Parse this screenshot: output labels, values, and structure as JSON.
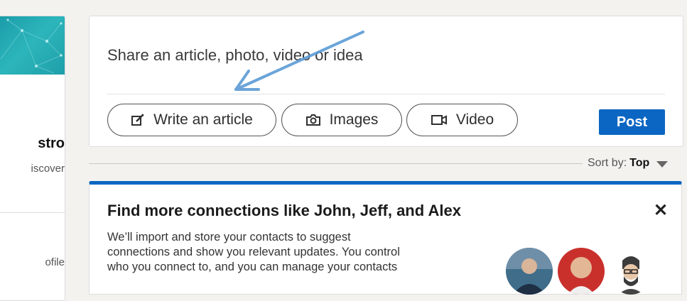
{
  "profile_card": {
    "name_fragment": "stro",
    "subtitle_fragment": "iscover",
    "link_fragment": "ofile"
  },
  "share_box": {
    "placeholder": "Share an article, photo, video or idea",
    "actions": [
      {
        "label": "Write an article",
        "icon": "pencil-edit-icon"
      },
      {
        "label": "Images",
        "icon": "camera-icon"
      },
      {
        "label": "Video",
        "icon": "video-camera-icon"
      }
    ],
    "post_label": "Post"
  },
  "feed": {
    "sort_label": "Sort by:",
    "sort_value": "Top"
  },
  "connections_card": {
    "title": "Find more connections like John, Jeff, and Alex",
    "description_lines": [
      "We’ll import and store your contacts to suggest",
      "connections and show you relevant updates. You control",
      "who you connect to, and you can manage your contacts"
    ],
    "close_icon": "✕"
  },
  "colors": {
    "brand_blue": "#0a66c2",
    "background": "#f3f2ef",
    "annotation_arrow": "#5b9bd5",
    "cover_teal": "#1f9fa9"
  }
}
